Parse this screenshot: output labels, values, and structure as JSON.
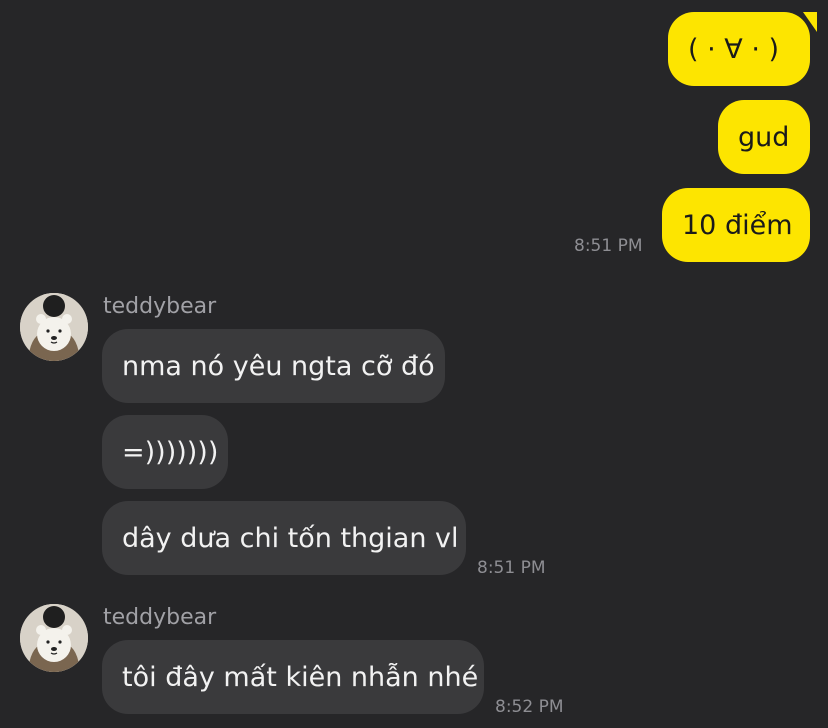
{
  "theme": {
    "background": "#262628",
    "outgoing_bubble": "#fde500",
    "incoming_bubble": "#3a3a3c",
    "timestamp_color": "#8e8e93"
  },
  "outgoing": {
    "messages": [
      "( · ∀ · )",
      "gud",
      "10 điểm"
    ],
    "time": "8:51 PM"
  },
  "groups": [
    {
      "sender": "teddybear",
      "avatar_icon": "avatar-person-holding-teddy-bear",
      "messages": [
        "nma nó yêu ngta cỡ đó",
        "=)))))))",
        "dây dưa chi tốn thgian vl"
      ],
      "time": "8:51 PM"
    },
    {
      "sender": "teddybear",
      "avatar_icon": "avatar-person-holding-teddy-bear",
      "messages": [
        "tôi đây mất kiên nhẫn nhé"
      ],
      "time": "8:52 PM"
    }
  ]
}
